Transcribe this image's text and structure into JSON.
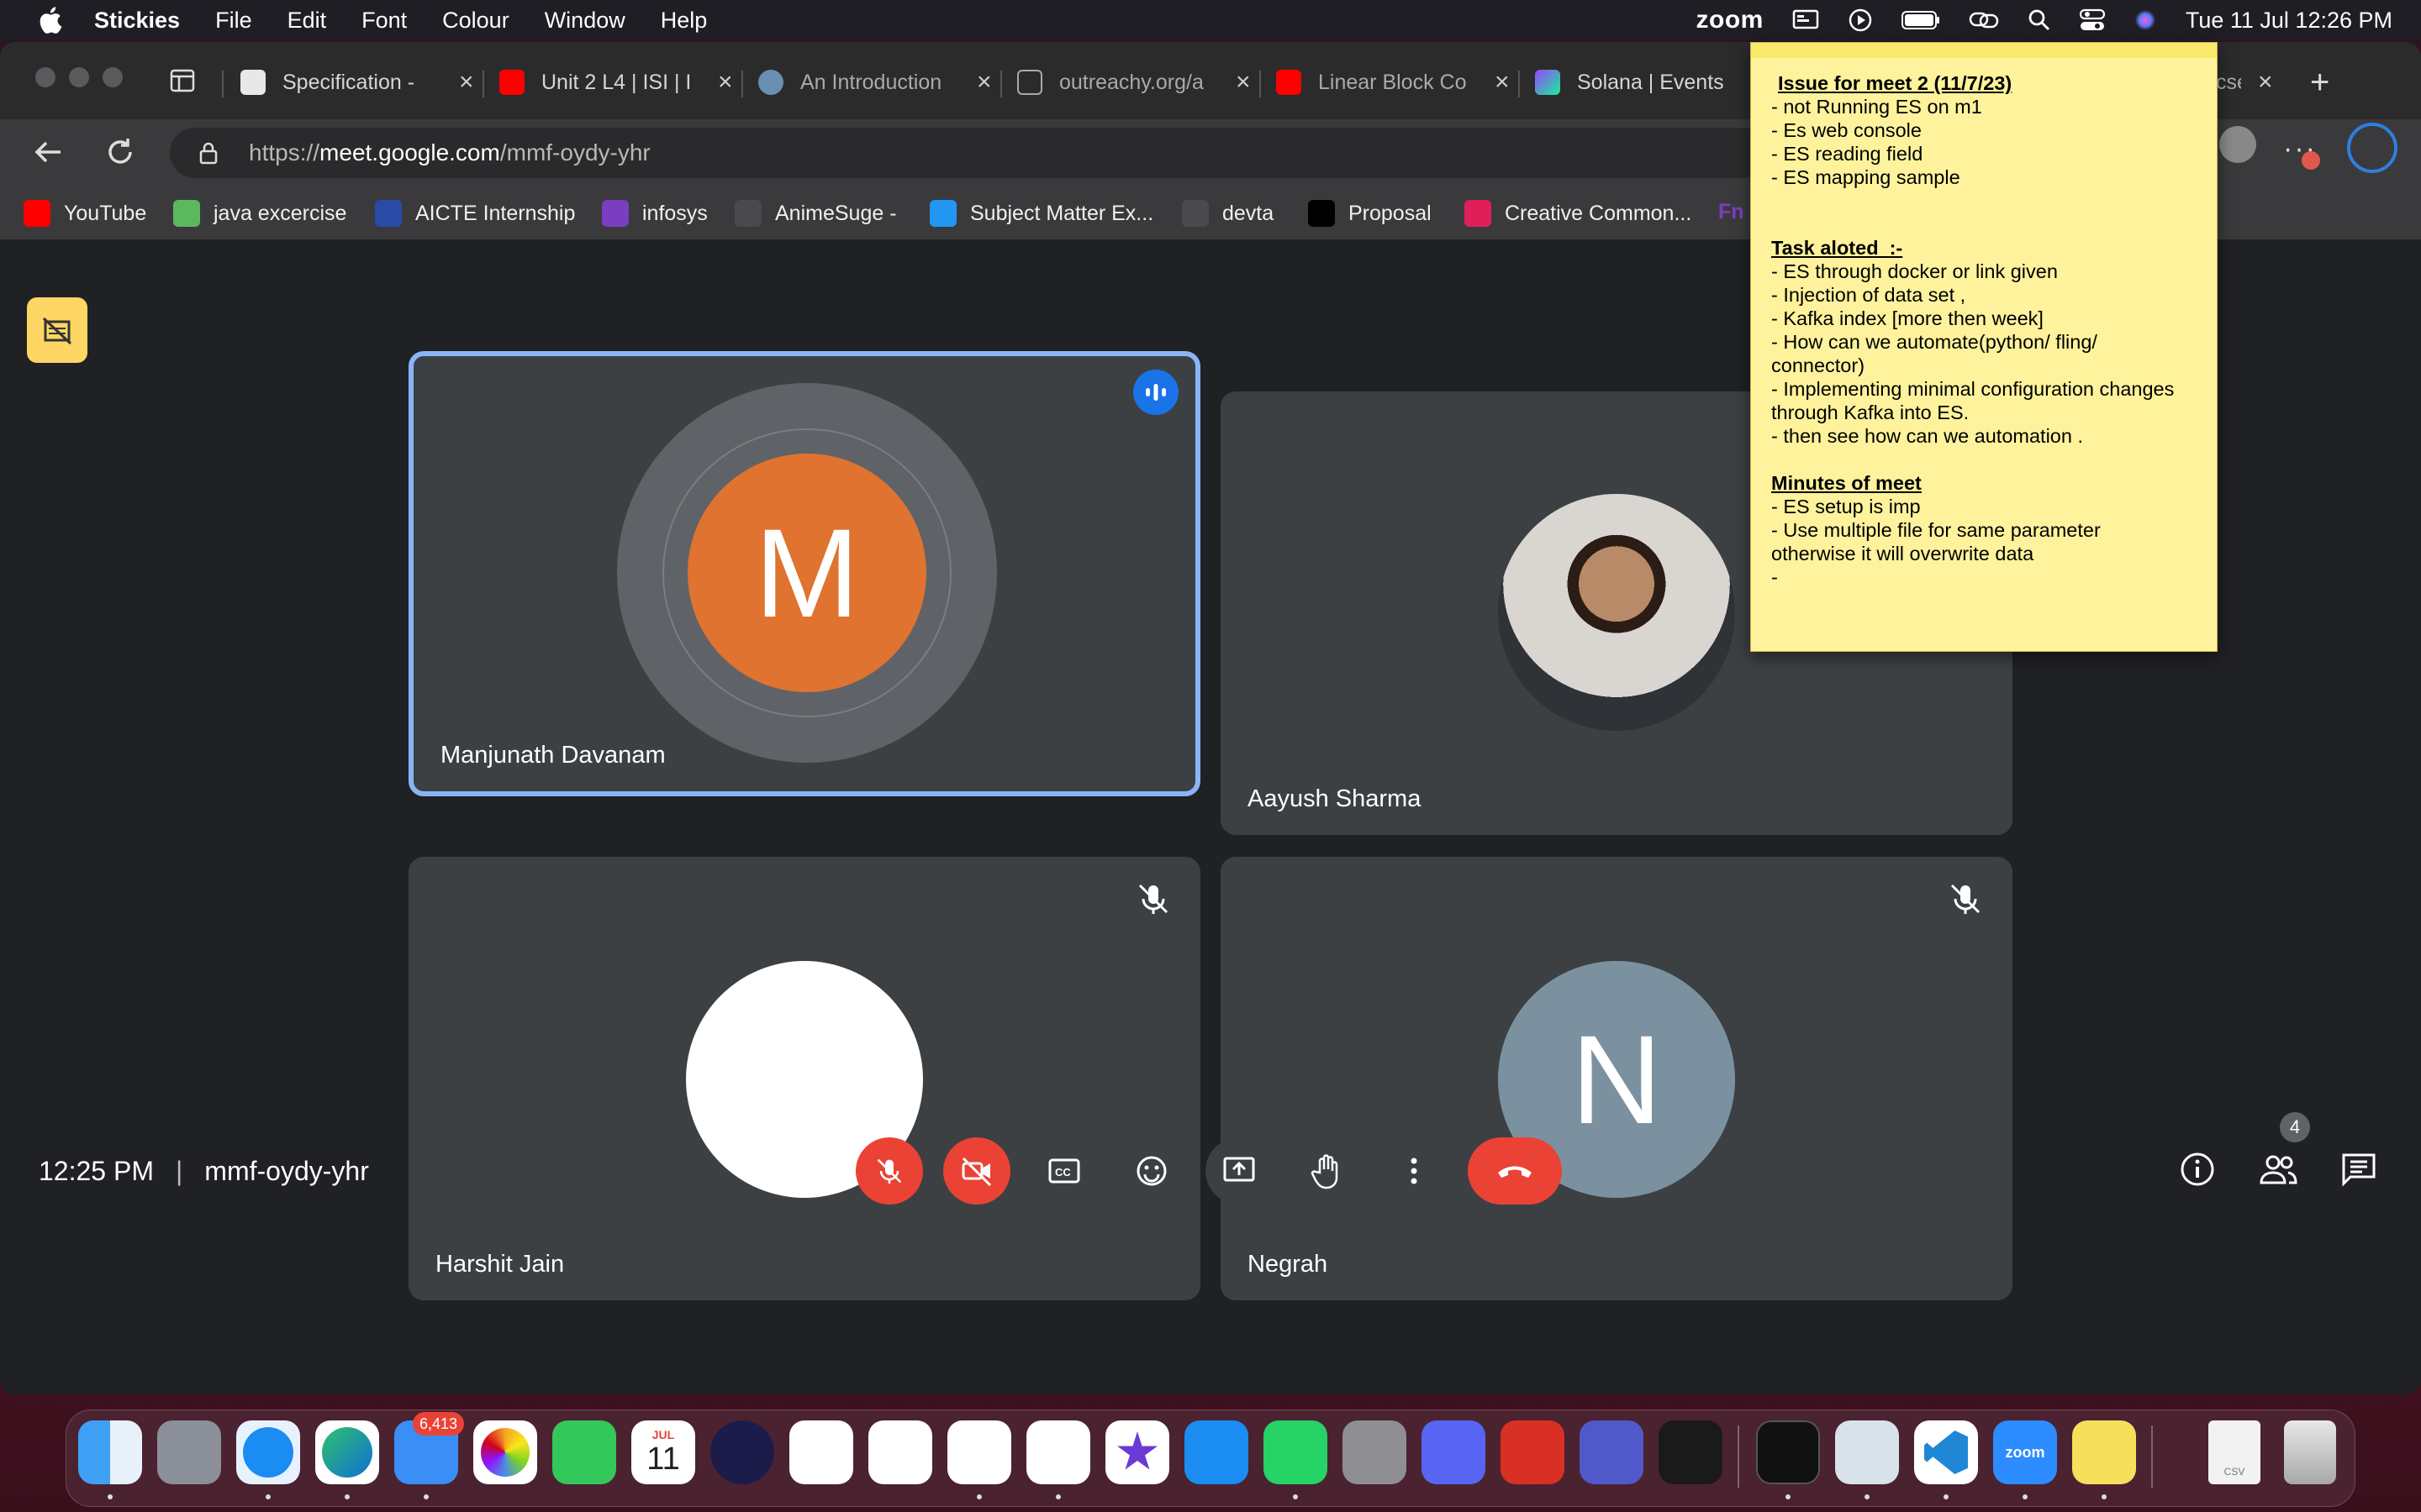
{
  "menubar": {
    "app_name": "Stickies",
    "items": [
      "File",
      "Edit",
      "Font",
      "Colour",
      "Window",
      "Help"
    ],
    "zoom_label": "zoom",
    "clock": "Tue 11 Jul  12:26 PM"
  },
  "browser": {
    "tabs": [
      {
        "label": "Specification - ",
        "icon": "document-icon"
      },
      {
        "label": "Unit 2 L4 | ISI | I",
        "icon": "youtube-icon"
      },
      {
        "label": "An Introduction",
        "icon": "globe-icon"
      },
      {
        "label": "outreachy.org/a",
        "icon": "page-icon"
      },
      {
        "label": "Linear Block Co",
        "icon": "youtube-icon"
      },
      {
        "label": "Solana | Events",
        "icon": "solana-icon"
      },
      {
        "label": "cse",
        "icon": "page-icon"
      }
    ],
    "url_scheme": "https://",
    "url_host": "meet.google.com",
    "url_path": "/mmf-oydy-yhr",
    "bookmarks": [
      {
        "label": "YouTube",
        "color": "#ff0000"
      },
      {
        "label": "java excercise",
        "color": "#5cb85c"
      },
      {
        "label": "AICTE Internship",
        "color": "#2a4aa8"
      },
      {
        "label": "infosys",
        "color": "#7a3fc0"
      },
      {
        "label": "AnimeSuge -",
        "color": "#3a3a3c"
      },
      {
        "label": "Subject Matter Ex...",
        "color": "#2196f3"
      },
      {
        "label": "devta",
        "color": "#3a3a3c"
      },
      {
        "label": "Proposal",
        "color": "#000000"
      },
      {
        "label": "Creative Common...",
        "color": "#e01e5a"
      },
      {
        "label": "Fn",
        "color": "#7a3fc0"
      }
    ]
  },
  "meet": {
    "participants": [
      {
        "name": "Manjunath Davanam",
        "initial": "M",
        "avatar_color": "#e07330",
        "speaking": true,
        "muted": false
      },
      {
        "name": "Aayush Sharma",
        "initial": "",
        "avatar_color": "#d8d4cf",
        "speaking": false,
        "muted": false
      },
      {
        "name": "Harshit Jain",
        "initial": "",
        "avatar_color": "#ffffff",
        "speaking": false,
        "muted": true
      },
      {
        "name": "Negrah",
        "initial": "N",
        "avatar_color": "#7b919f",
        "speaking": false,
        "muted": true
      }
    ],
    "time": "12:25 PM",
    "separator": "|",
    "meeting_code": "mmf-oydy-yhr",
    "people_count": "4"
  },
  "sticky": {
    "title": "Issue for meet 2 (11/7/23)",
    "issues": [
      "- not Running ES on m1",
      "- Es web console",
      "- ES reading field",
      "- ES mapping sample"
    ],
    "tasks_heading": "Task aloted  :-",
    "tasks": [
      "- ES through docker or link given",
      "- Injection of data set ,",
      "- Kafka index [more then week]",
      "- How can we automate(python/ fling/",
      "connector)",
      "- Implementing minimal configuration changes",
      "through Kafka into ES.",
      "- then see how can we automation ."
    ],
    "minutes_heading": "Minutes of meet",
    "minutes": [
      "- ES setup is imp",
      "- Use multiple file for same parameter",
      "otherwise it will overwrite data",
      "-"
    ]
  },
  "dock": {
    "mail_badge": "6,413",
    "calendar_month": "JUL",
    "calendar_day": "11",
    "zoom_label": "zoom",
    "csv_label": "CSV"
  }
}
